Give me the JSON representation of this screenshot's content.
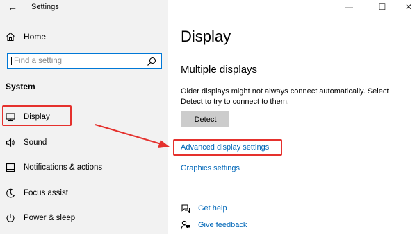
{
  "window": {
    "title": "Settings",
    "back_icon": "arrow-left-icon",
    "controls": {
      "minimize": "—",
      "maximize": "☐",
      "close": "✕"
    }
  },
  "sidebar": {
    "home_label": "Home",
    "search_placeholder": "Find a setting",
    "section_heading": "System",
    "items": [
      {
        "label": "Display",
        "icon": "monitor-icon",
        "highlighted": true
      },
      {
        "label": "Sound",
        "icon": "speaker-icon"
      },
      {
        "label": "Notifications & actions",
        "icon": "notification-icon"
      },
      {
        "label": "Focus assist",
        "icon": "moon-icon"
      },
      {
        "label": "Power & sleep",
        "icon": "power-icon"
      }
    ]
  },
  "main": {
    "title": "Display",
    "section_title": "Multiple displays",
    "description": "Older displays might not always connect automatically. Select Detect to try to connect to them.",
    "detect_button": "Detect",
    "advanced_link": "Advanced display settings",
    "graphics_link": "Graphics settings",
    "help": [
      {
        "label": "Get help",
        "icon": "chat-help-icon"
      },
      {
        "label": "Give feedback",
        "icon": "feedback-icon"
      }
    ]
  },
  "annotation": {
    "color": "#e5312d"
  },
  "accent": "#0078d7",
  "link_color": "#0067b8"
}
